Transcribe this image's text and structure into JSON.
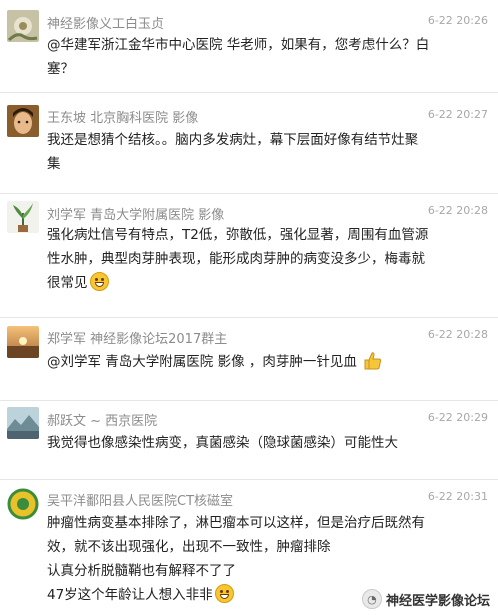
{
  "messages": [
    {
      "sender": "神经影像义工白玉贞",
      "time": "6-22 20:26",
      "lines": [
        "@华建军浙江金华市中心医院 华老师，如果有，您考虑什么？白",
        "塞？"
      ],
      "avatar": "flower-avatar"
    },
    {
      "sender": "王东坡 北京胸科医院 影像",
      "time": "6-22 20:27",
      "lines": [
        "我还是想猜个结核。。脑内多发病灶，幕下层面好像有结节灶聚",
        "集"
      ],
      "avatar": "portrait-avatar"
    },
    {
      "sender": "刘学军 青岛大学附属医院 影像",
      "time": "6-22 20:28",
      "lines": [
        "强化病灶信号有特点，T2低，弥散低，强化显著，周围有血管源",
        "性水肿，典型肉芽肿表现，能形成肉芽肿的病变没多少，梅毒就",
        "很常见"
      ],
      "avatar": "plant-avatar"
    },
    {
      "sender": "郑学军    神经影像论坛2017群主",
      "time": "6-22 20:28",
      "lines": [
        "@刘学军 青岛大学附属医院 影像 ，肉芽肿一针见血"
      ],
      "avatar": "sunset-avatar"
    },
    {
      "sender": "郝跃文 ~ 西京医院",
      "time": "6-22 20:29",
      "lines": [
        "我觉得也像感染性病变，真菌感染（隐球菌感染）可能性大"
      ],
      "avatar": "landscape-avatar"
    },
    {
      "sender": "吴平洋鄱阳县人民医院CT核磁室",
      "time": "6-22 20:31",
      "lines": [
        "肿瘤性病变基本排除了，淋巴瘤本可以这样，但是治疗后既然有",
        "效，就不该出现强化，出现不一致性，肿瘤排除",
        "认真分析脱髓鞘也有解释不了了",
        "47岁这个年龄让人想入非非"
      ],
      "avatar": "badge-avatar"
    }
  ],
  "watermark": {
    "text": "神经医学影像论坛",
    "icon": "wechat-icon"
  }
}
